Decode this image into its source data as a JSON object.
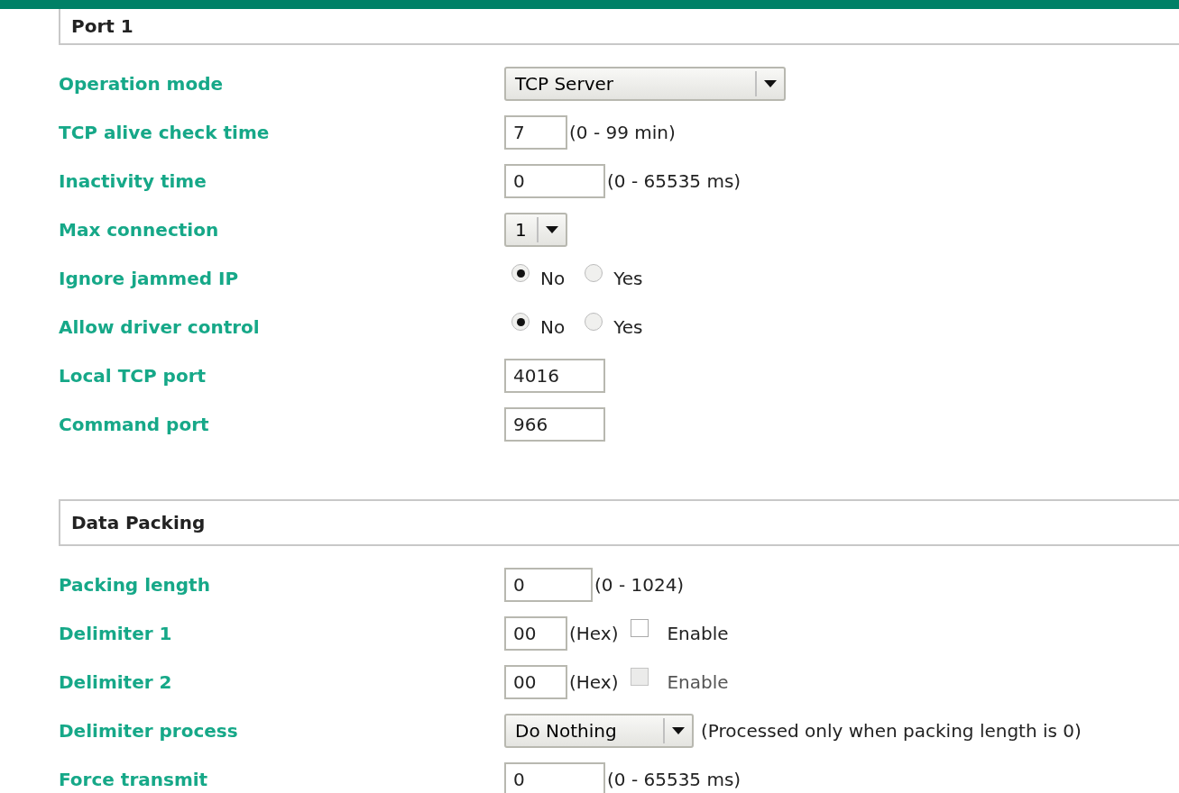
{
  "sections": [
    {
      "title": "Port 1",
      "rows": [
        {
          "kind": "select",
          "label": "Operation mode",
          "value": "TCP Server"
        },
        {
          "kind": "text",
          "label": "TCP alive check time",
          "value": "7",
          "hint": "(0 - 99 min)"
        },
        {
          "kind": "text",
          "label": "Inactivity time",
          "value": "0",
          "hint": "(0 - 65535 ms)"
        },
        {
          "kind": "select",
          "label": "Max connection",
          "value": "1"
        },
        {
          "kind": "radio",
          "label": "Ignore jammed IP",
          "options": [
            {
              "label": "No",
              "selected": true
            },
            {
              "label": "Yes",
              "selected": false
            }
          ]
        },
        {
          "kind": "radio",
          "label": "Allow driver control",
          "options": [
            {
              "label": "No",
              "selected": true
            },
            {
              "label": "Yes",
              "selected": false
            }
          ]
        },
        {
          "kind": "text",
          "label": "Local TCP port",
          "value": "4016"
        },
        {
          "kind": "text",
          "label": "Command port",
          "value": "966"
        }
      ]
    },
    {
      "title": "Data Packing",
      "rows": [
        {
          "kind": "text",
          "label": "Packing length",
          "value": "0",
          "hint": "(0 - 1024)"
        },
        {
          "kind": "text",
          "label": "Delimiter 1",
          "value": "00",
          "hint": "(Hex)",
          "checkbox": {
            "label": "Enable",
            "checked": false,
            "disabled": false
          }
        },
        {
          "kind": "text",
          "label": "Delimiter 2",
          "value": "00",
          "hint": "(Hex)",
          "checkbox": {
            "label": "Enable",
            "checked": false,
            "disabled": true
          }
        },
        {
          "kind": "select",
          "label": "Delimiter process",
          "value": "Do Nothing",
          "hint": "(Processed only when packing length is 0)"
        },
        {
          "kind": "text",
          "label": "Force transmit",
          "value": "0",
          "hint": "(0 - 65535 ms)"
        }
      ]
    }
  ]
}
